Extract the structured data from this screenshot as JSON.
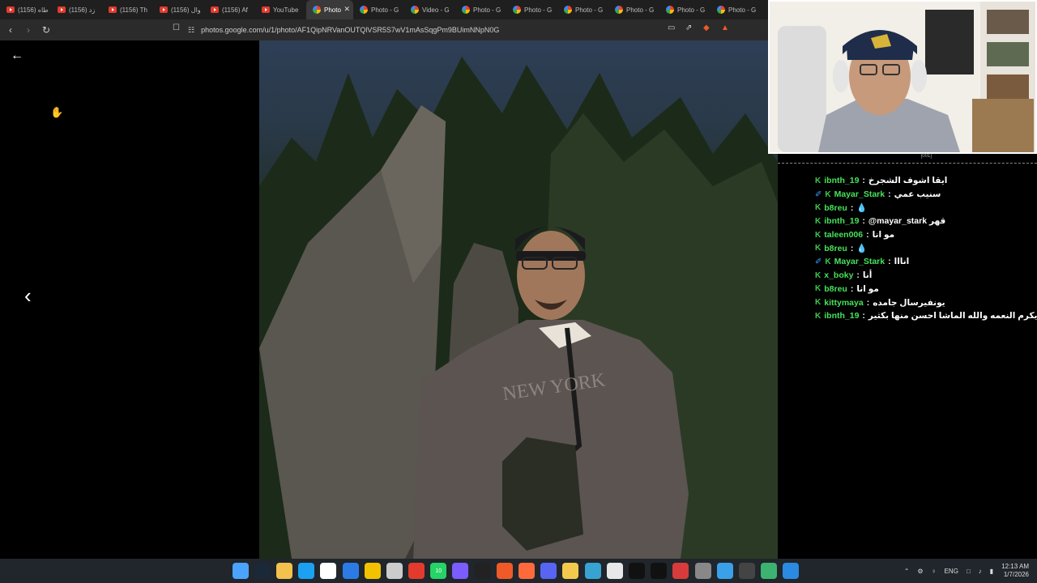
{
  "browser": {
    "tabs": [
      {
        "label": "(1156) طاه",
        "icon": "youtube-icon"
      },
      {
        "label": "(1156) زد",
        "icon": "youtube-icon"
      },
      {
        "label": "(1156) Th",
        "icon": "youtube-icon"
      },
      {
        "label": "(1156) وال",
        "icon": "youtube-icon"
      },
      {
        "label": "(1156) Af",
        "icon": "youtube-icon"
      },
      {
        "label": "YouTube",
        "icon": "youtube-icon"
      },
      {
        "label": "Photo",
        "icon": "google-photos-icon",
        "active": true
      },
      {
        "label": "Photo - G",
        "icon": "google-photos-icon"
      },
      {
        "label": "Video - G",
        "icon": "google-photos-icon"
      },
      {
        "label": "Photo - G",
        "icon": "google-photos-icon"
      },
      {
        "label": "Photo - G",
        "icon": "google-photos-icon"
      },
      {
        "label": "Photo - G",
        "icon": "google-photos-icon"
      },
      {
        "label": "Photo - G",
        "icon": "google-photos-icon"
      },
      {
        "label": "Photo - G",
        "icon": "google-photos-icon"
      },
      {
        "label": "Photo - G",
        "icon": "google-photos-icon"
      }
    ],
    "close_glyph": "✕",
    "url": "photos.google.com/u/1/photo/AF1QipNRVanOUTQlVSR5S7wV1mAsSqgPm9BUimNNpN0G"
  },
  "viewer": {
    "back_glyph": "←",
    "prev_glyph": "‹"
  },
  "chat": {
    "header": "[001]",
    "messages": [
      {
        "user": "ibnth_19",
        "text": "ايقا اشوف الشجرخ",
        "mod": false
      },
      {
        "user": "Mayar_Stark",
        "text": "سنيب عمي",
        "mod": true
      },
      {
        "user": "b8reu",
        "text": "💧",
        "mod": false
      },
      {
        "user": "ibnth_19",
        "text": "@mayar_stark قهر",
        "mod": false
      },
      {
        "user": "taleen006",
        "text": "مو انا",
        "mod": false
      },
      {
        "user": "b8reu",
        "text": "💧",
        "mod": false
      },
      {
        "user": "Mayar_Stark",
        "text": "انااا",
        "mod": true
      },
      {
        "user": "x_boky",
        "text": "أنا",
        "mod": false
      },
      {
        "user": "b8reu",
        "text": "مو انا",
        "mod": false
      },
      {
        "user": "kittymaya",
        "text": "يونفيرسال جامده",
        "mod": false
      },
      {
        "user": "ibnth_19",
        "text": "يا استغفر الله الله يكرم النعمه والله الماشا احسن منها بكثير",
        "mod": false
      }
    ]
  },
  "taskbar": {
    "apps": [
      "windows-start-icon",
      "steam-icon",
      "file-explorer-icon",
      "edge-icon",
      "store-icon",
      "mail-icon",
      "notes-icon",
      "settings-icon",
      "media-icon",
      "whatsapp-icon",
      "phone-link-icon",
      "github-icon",
      "brave-icon",
      "office-icon",
      "discord-icon",
      "chat-bubble-icon",
      "app-icon",
      "chrome-icon",
      "notion-icon",
      "obs-icon",
      "capture-icon",
      "gear-icon",
      "vscode-icon",
      "terminal-icon",
      "maps-icon",
      "photos-icon"
    ],
    "whatsapp_badge": "10",
    "lang": "ENG",
    "time": "12:13 AM",
    "date": "1/7/2026"
  }
}
